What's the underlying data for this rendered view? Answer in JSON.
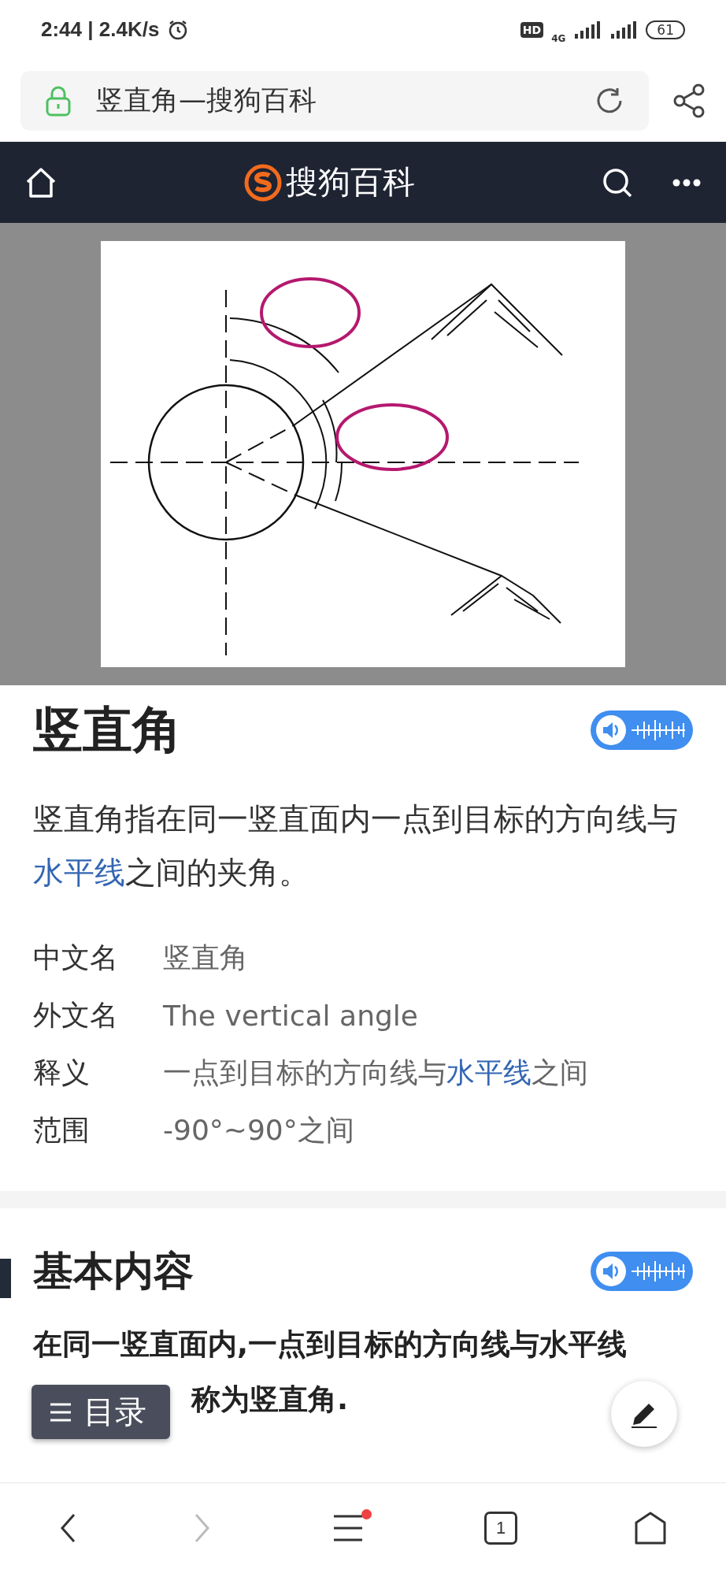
{
  "status_bar": {
    "time": "2:44 | 2.4K/s",
    "hd_badge": "HD",
    "network": "4G",
    "battery": "61"
  },
  "address_bar": {
    "title": "竖直角—搜狗百科",
    "secure": true
  },
  "site_header": {
    "logo_text": "搜狗百科"
  },
  "article": {
    "title": "竖直角",
    "summary": [
      {
        "kind": "text",
        "text": "竖直角指在同一竖直面内一点到目标的方向线与"
      },
      {
        "kind": "link",
        "text": "水平线"
      },
      {
        "kind": "text",
        "text": "之间的夹角。"
      }
    ],
    "infobox": [
      {
        "label": "中文名",
        "value": [
          {
            "kind": "text",
            "text": "竖直角"
          }
        ]
      },
      {
        "label": "外文名",
        "value": [
          {
            "kind": "text",
            "text": "The vertical angle"
          }
        ]
      },
      {
        "label": "释义",
        "value": [
          {
            "kind": "text",
            "text": "一点到目标的方向线与"
          },
          {
            "kind": "link",
            "text": "水平线"
          },
          {
            "kind": "text",
            "text": "之间"
          }
        ]
      },
      {
        "label": "范围",
        "value": [
          {
            "kind": "text",
            "text": "-90°~90°之间"
          }
        ]
      }
    ]
  },
  "sections": [
    {
      "heading": "基本内容",
      "paragraph_lines": [
        "在同一竖直面内,一点到目标的方向线与水平线",
        "称为竖直角."
      ]
    }
  ],
  "toc_button": {
    "label": "目录"
  },
  "bottom_bar": {
    "items": [
      {
        "kind": "back",
        "disabled": false
      },
      {
        "kind": "forward",
        "disabled": true
      },
      {
        "kind": "menu",
        "badge": true
      },
      {
        "kind": "tabs",
        "count": "1"
      },
      {
        "kind": "home"
      }
    ]
  }
}
